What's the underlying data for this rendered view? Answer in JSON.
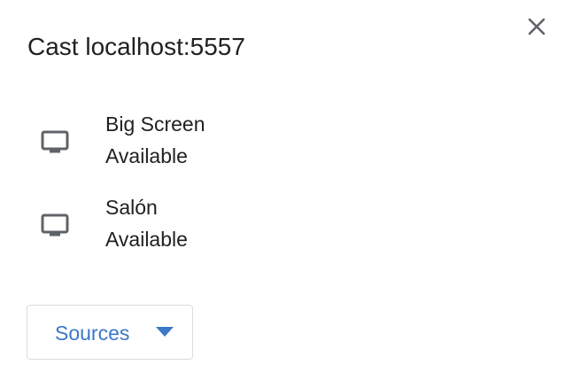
{
  "dialog": {
    "title": "Cast localhost:5557",
    "close_icon": "close-icon"
  },
  "sinks": [
    {
      "name": "Big Screen",
      "status": "Available",
      "icon": "monitor-icon"
    },
    {
      "name": "Salón",
      "status": "Available",
      "icon": "monitor-icon"
    }
  ],
  "sources": {
    "label": "Sources",
    "icon": "caret-down-icon"
  },
  "colors": {
    "text": "#202124",
    "icon": "#5f6368",
    "accent": "#3c78c8",
    "border": "#dadce0"
  }
}
